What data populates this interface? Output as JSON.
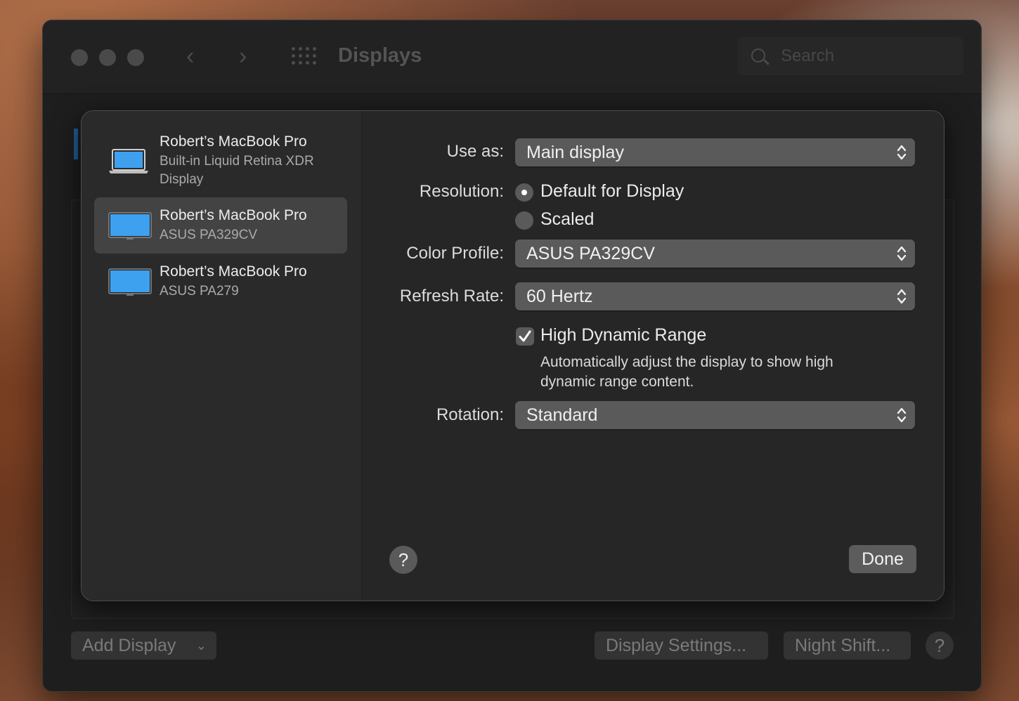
{
  "window": {
    "title": "Displays",
    "search_placeholder": "Search"
  },
  "footer": {
    "add_display": "Add Display",
    "display_settings": "Display Settings...",
    "night_shift": "Night Shift...",
    "help": "?"
  },
  "sheet": {
    "displays": [
      {
        "name": "Robert’s MacBook Pro",
        "subtitle": "Built-in Liquid Retina XDR Display",
        "icon": "laptop-icon",
        "selected": false
      },
      {
        "name": "Robert’s MacBook Pro",
        "subtitle": "ASUS PA329CV",
        "icon": "monitor-icon",
        "selected": true
      },
      {
        "name": "Robert’s MacBook Pro",
        "subtitle": "ASUS PA279",
        "icon": "monitor-icon",
        "selected": false
      }
    ],
    "use_as": {
      "label": "Use as:",
      "value": "Main display"
    },
    "resolution": {
      "label": "Resolution:",
      "options": [
        "Default for Display",
        "Scaled"
      ],
      "selected": "Default for Display"
    },
    "color_profile": {
      "label": "Color Profile:",
      "value": "ASUS PA329CV"
    },
    "refresh_rate": {
      "label": "Refresh Rate:",
      "value": "60 Hertz"
    },
    "hdr": {
      "label": "High Dynamic Range",
      "checked": true,
      "description": "Automatically adjust the display to show high dynamic range content."
    },
    "rotation": {
      "label": "Rotation:",
      "value": "Standard"
    },
    "help": "?",
    "done": "Done"
  },
  "colors": {
    "screen_blue": "#3ea1f0",
    "selected_row": "#434343"
  }
}
